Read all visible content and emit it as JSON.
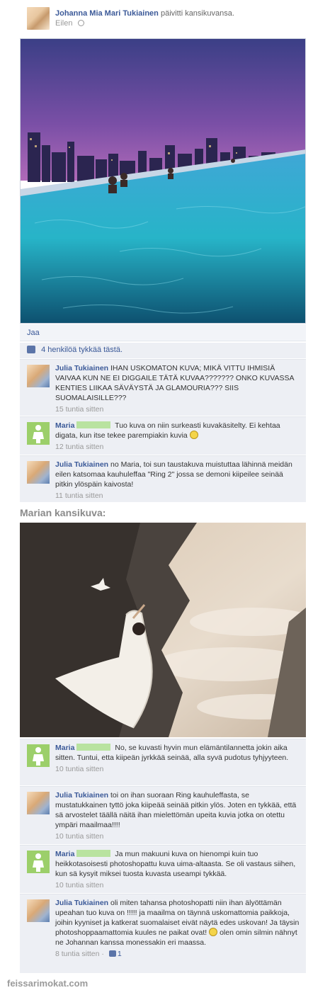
{
  "post": {
    "author": "Johanna Mia Mari Tukiainen",
    "action": "päivitti kansikuvansa.",
    "time": "Eilen",
    "share_label": "Jaa",
    "likes_text": "4 henkilöä tykkää tästä."
  },
  "comments_top": [
    {
      "author": "Julia Tukiainen",
      "text": "IHAN USKOMATON KUVA; MIKÄ VITTU IHMISIÄ VAIVAA KUN NE EI DIGGAILE TÄTÄ KUVAA??????? ONKO KUVASSA KENTIES LIIKAA SÄVÄYSTÄ JA GLAMOURIA??? SIIS SUOMALAISILLE???",
      "time": "15 tuntia sitten"
    },
    {
      "author": "Maria",
      "text": "Tuo kuva on niin surkeasti kuvakäsitelty. Ei kehtaa digata, kun itse tekee parempiakin kuvia",
      "time": "12 tuntia sitten"
    },
    {
      "author": "Julia Tukiainen",
      "text": "no Maria, toi sun taustakuva muistuttaa lähinnä meidän eilen katsomaa kauhuleffaa \"Ring 2\" jossa se demoni kiipeilee seinää pitkin ylöspäin kaivosta!",
      "time": "11 tuntia sitten"
    }
  ],
  "section_label": "Marian kansikuva:",
  "comments_bottom": [
    {
      "author": "Maria",
      "text": "No, se kuvasti hyvin mun elämäntilannetta jokin aika sitten. Tuntui, etta kiipeän jyrkkää seinää, alla syvä pudotus tyhjyyteen.",
      "time": "10 tuntia sitten"
    },
    {
      "author": "Julia Tukiainen",
      "text": "toi on ihan suoraan Ring kauhuleffasta, se mustatukkainen tyttö joka kiipeää seinää pitkin ylös. Joten en tykkää, että sä arvostelet täällä näitä ihan mielettömän upeita kuvia jotka on otettu ympäri maailmaa!!!!",
      "time": "10 tuntia sitten"
    },
    {
      "author": "Maria",
      "text": "Ja mun makuuni kuva on hienompi kuin tuo heikkotasoisesti photoshopattu kuva uima-altaasta. Se oli vastaus siihen, kun sä kysyit miksei tuosta kuvasta useampi tykkää.",
      "time": "10 tuntia sitten"
    },
    {
      "author": "Julia Tukiainen",
      "text": "oli miten tahansa photoshopatti niin ihan älyöttämän upeahan tuo kuva on !!!!! ja maailma on täynnä uskomattomia paikkoja, joihin kyyniset ja katkerat suomalaiset eivät näytä edes uskovan! Ja täysin photoshoppaamattomia kuules ne paikat ovat!",
      "text2": "olen omin silmin nähnyt ne Johannan kanssa monessakin eri maassa.",
      "time": "8 tuntia sitten",
      "likes": "1"
    }
  ],
  "watermark": "feissarimokat.com"
}
